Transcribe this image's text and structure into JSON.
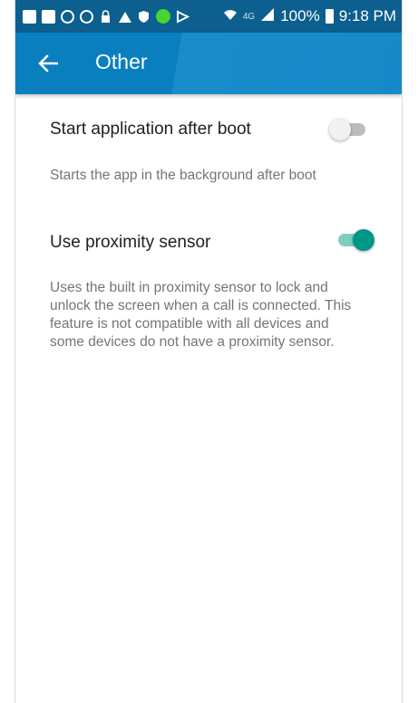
{
  "status_bar": {
    "battery_percent": "100%",
    "time": "9:18 PM",
    "network_label": "4G",
    "left_icons": [
      "checkbox-icon",
      "image-icon",
      "sync-icon",
      "sync-icon",
      "lock-icon",
      "alarm-icon",
      "shield-icon",
      "green-dot-icon",
      "play-icon"
    ]
  },
  "app_bar": {
    "title": "Other",
    "back_icon": "arrow-left-icon"
  },
  "settings": [
    {
      "title": "Start application after boot",
      "description": "Starts the app in the background after boot",
      "enabled": false
    },
    {
      "title": "Use proximity sensor",
      "description": "Uses the built in proximity sensor to lock and unlock the screen when a call is connected. This feature is not compatible with all devices and some devices do not have a proximity sensor.",
      "enabled": true
    }
  ],
  "colors": {
    "status_bar": "#0c5f8f",
    "app_bar": "#0a7fc0",
    "switch_on": "#009688",
    "switch_on_track": "#80cbc4",
    "switch_off_track": "#bdbdbd"
  }
}
